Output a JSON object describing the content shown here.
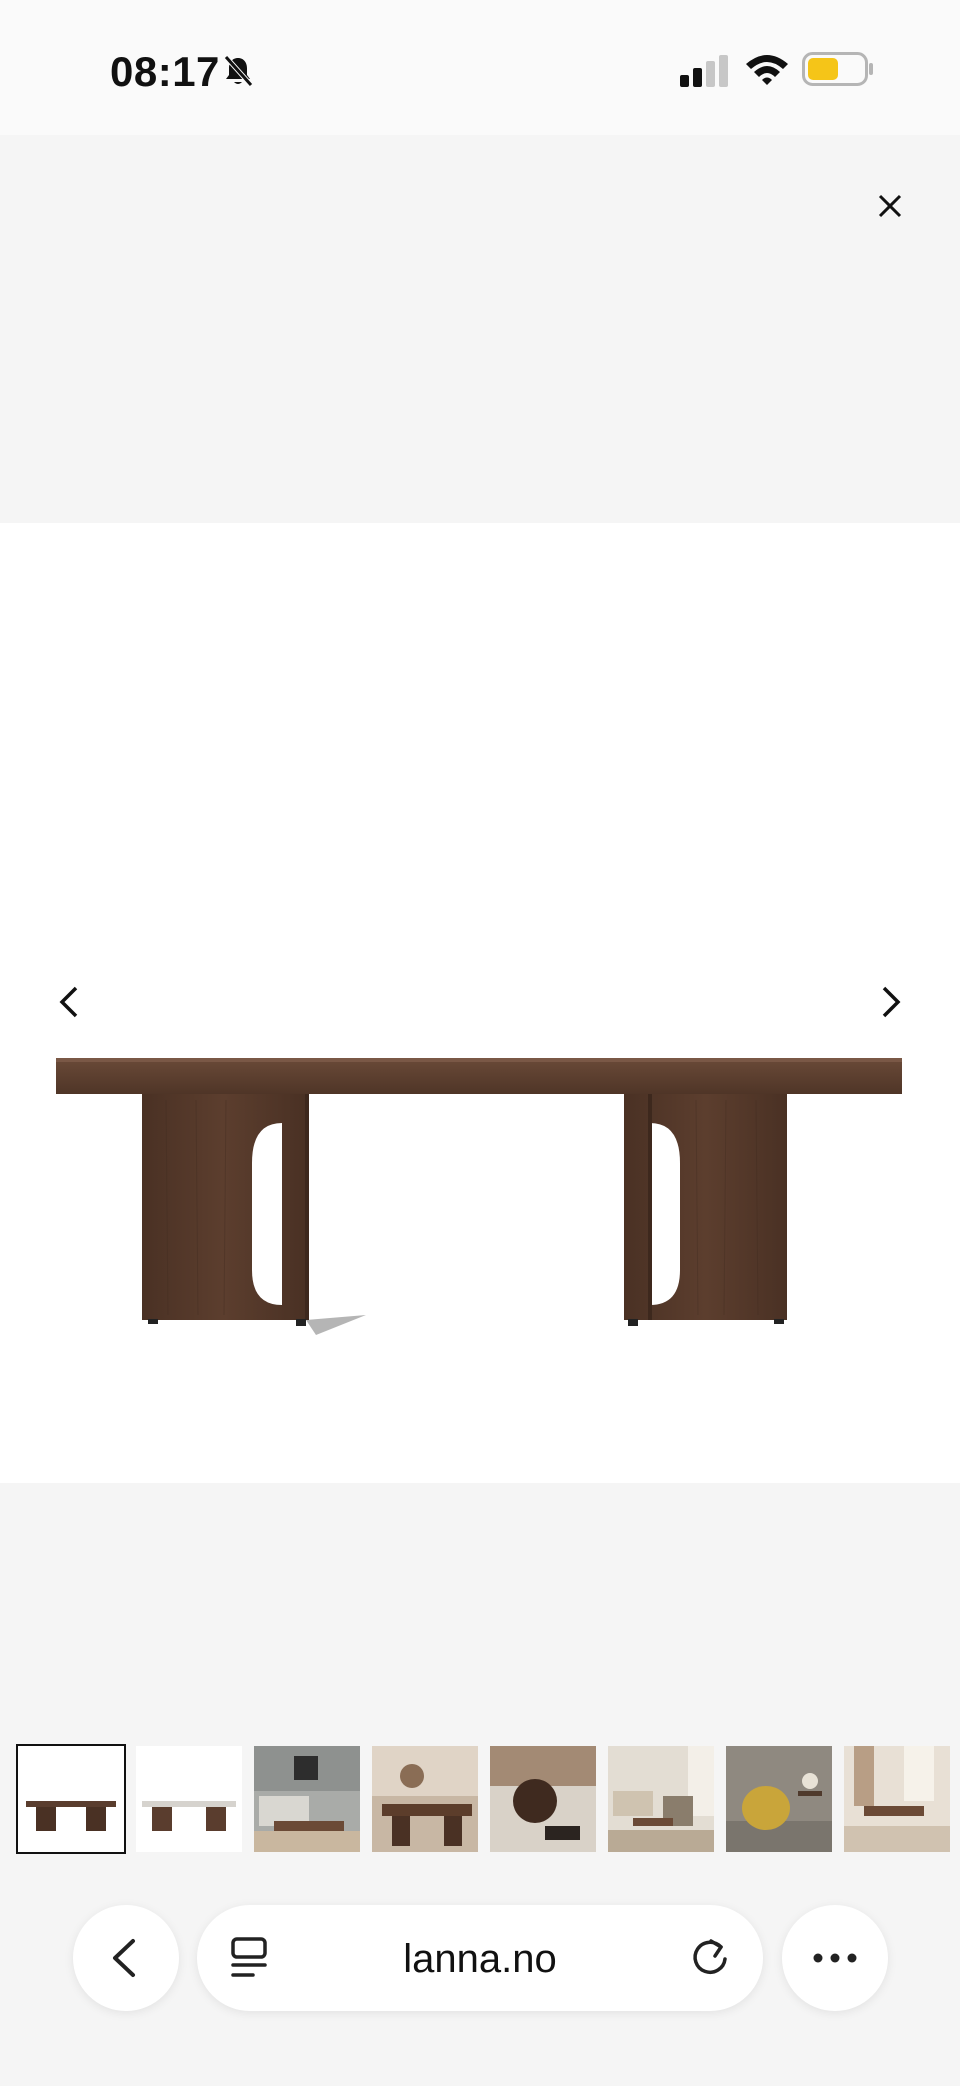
{
  "status_bar": {
    "time": "08:17",
    "icons": [
      "bell-slash-icon",
      "cellular-signal-icon",
      "wifi-icon",
      "battery-icon"
    ],
    "battery_color": "#f5c518",
    "battery_level": 0.55
  },
  "viewer": {
    "close_icon": "close-icon",
    "prev_icon": "chevron-left-icon",
    "next_icon": "chevron-right-icon",
    "product_image": "walnut-coffee-table",
    "thumbnails": [
      {
        "name": "thumb-table-dark",
        "selected": true
      },
      {
        "name": "thumb-table-marble",
        "selected": false
      },
      {
        "name": "thumb-living-room-gray",
        "selected": false
      },
      {
        "name": "thumb-table-closeup",
        "selected": false
      },
      {
        "name": "thumb-vase-detail",
        "selected": false
      },
      {
        "name": "thumb-living-room-bright",
        "selected": false
      },
      {
        "name": "thumb-yellow-chair",
        "selected": false
      },
      {
        "name": "thumb-living-room-window",
        "selected": false
      }
    ]
  },
  "browser": {
    "url": "lanna.no",
    "back_icon": "chevron-left-icon",
    "reader_icon": "reader-icon",
    "reload_icon": "reload-icon",
    "more_icon": "more-icon"
  },
  "colors": {
    "background": "#f5f5f5",
    "wood": "#5a3d2e"
  }
}
